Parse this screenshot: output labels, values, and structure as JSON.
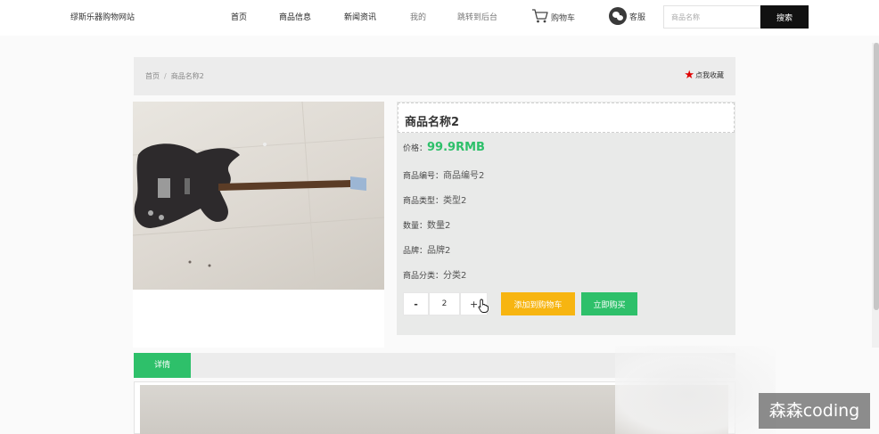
{
  "header": {
    "site_title": "缪斯乐器购物网站",
    "nav": {
      "home": "首页",
      "products": "商品信息",
      "news": "新闻资讯",
      "mine": "我的",
      "admin": "跳转到后台",
      "cart": "购物车",
      "service": "客服"
    },
    "search": {
      "placeholder": "商品名称",
      "value": "",
      "button": "搜索"
    }
  },
  "breadcrumb": {
    "home": "首页",
    "separator": "/",
    "current": "商品名称2"
  },
  "favorite": {
    "label": "点我收藏"
  },
  "product": {
    "title": "商品名称2",
    "price_label": "价格：",
    "price": "99.9RMB",
    "fields": [
      {
        "label": "商品编号：",
        "value": "商品编号2"
      },
      {
        "label": "商品类型：",
        "value": "类型2"
      },
      {
        "label": "数量：",
        "value": "数量2"
      },
      {
        "label": "品牌：",
        "value": "品牌2"
      },
      {
        "label": "商品分类：",
        "value": "分类2"
      }
    ]
  },
  "purchase": {
    "minus": "-",
    "quantity": "2",
    "plus": "+",
    "add_to_cart": "添加到购物车",
    "buy_now": "立即购买"
  },
  "tabs": {
    "detail": "详情"
  },
  "watermark": "森森coding",
  "colors": {
    "accent_green": "#2ec06a",
    "accent_orange": "#f7b511",
    "favorite_star": "#e00000",
    "search_button": "#111111"
  }
}
